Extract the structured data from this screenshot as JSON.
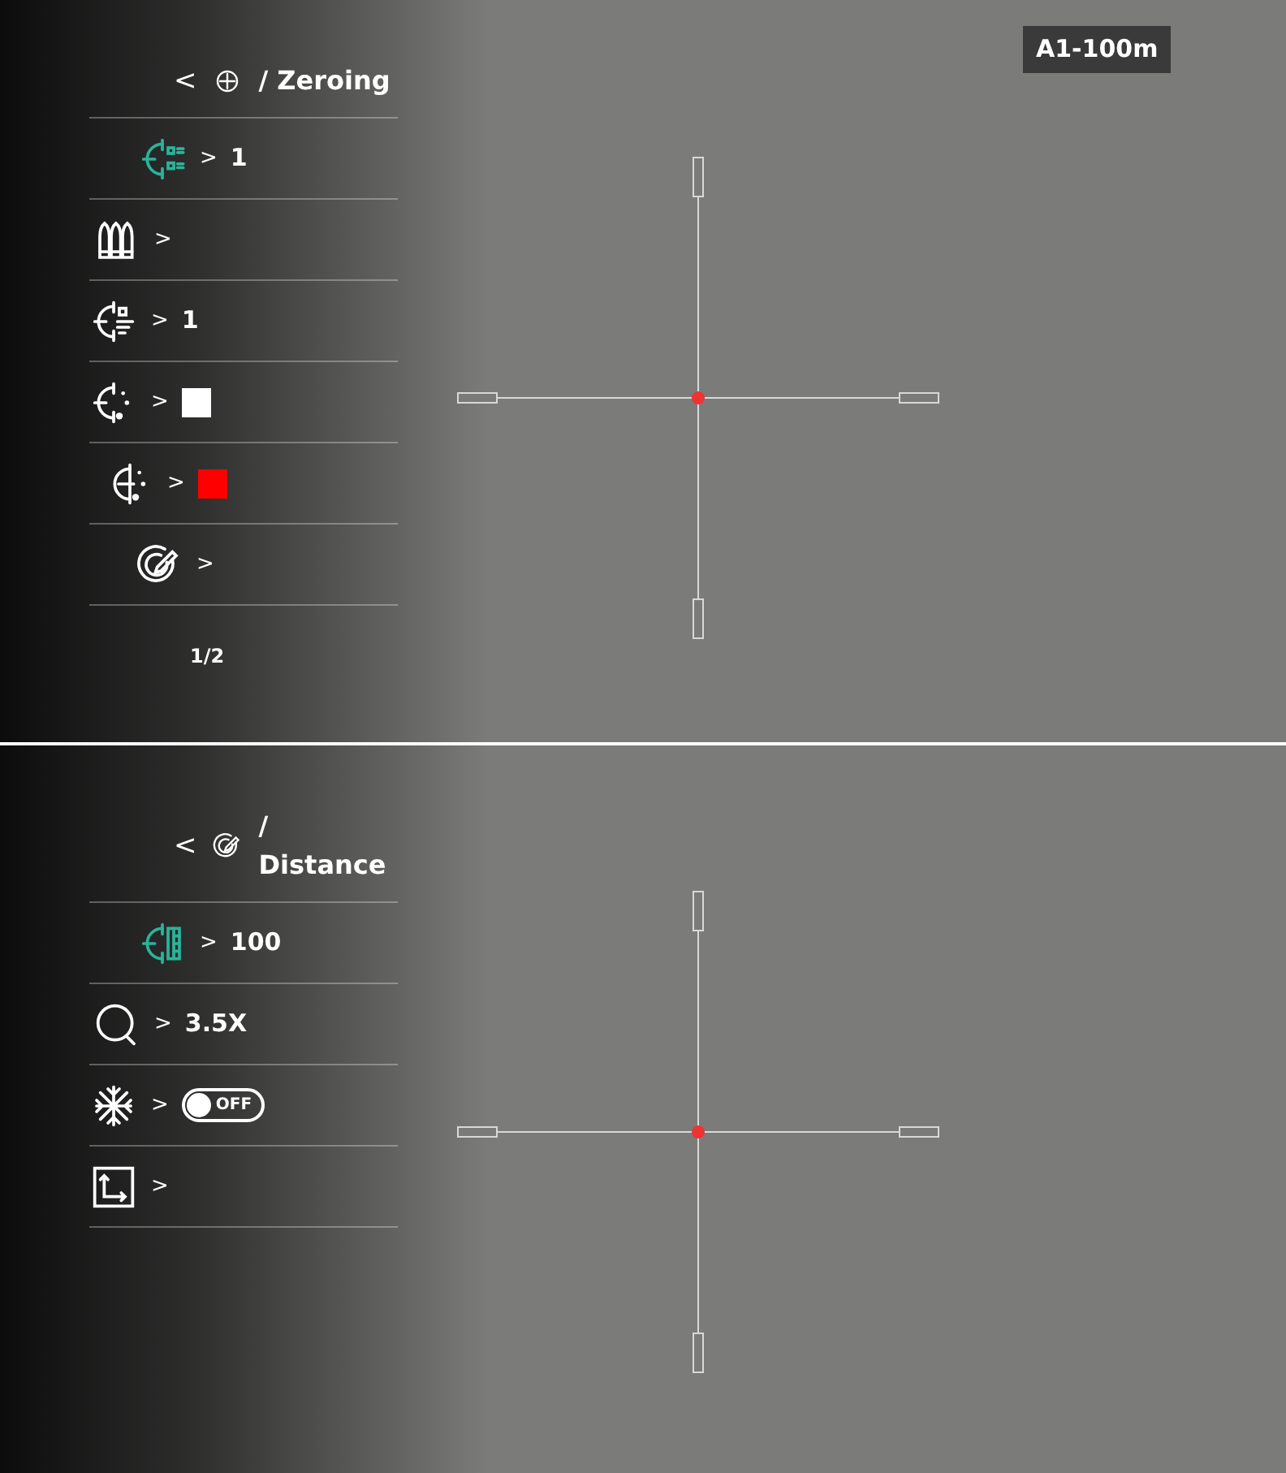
{
  "screens": [
    {
      "header": {
        "back": "<",
        "title": "/ Zeroing"
      },
      "badge": "A1-100m",
      "items": [
        {
          "kind": "text",
          "selected": true,
          "arrow": ">",
          "value": "1"
        },
        {
          "kind": "none",
          "selected": false,
          "arrow": ">"
        },
        {
          "kind": "text",
          "selected": false,
          "arrow": ">",
          "value": "1"
        },
        {
          "kind": "swatch",
          "selected": false,
          "arrow": ">",
          "color": "#ffffff"
        },
        {
          "kind": "swatch",
          "selected": false,
          "arrow": ">",
          "color": "#ff0000"
        },
        {
          "kind": "none",
          "selected": false,
          "arrow": ">"
        }
      ],
      "page": "1/2"
    },
    {
      "header": {
        "back": "<",
        "title": "/ Distance"
      },
      "items": [
        {
          "kind": "text",
          "selected": true,
          "arrow": ">",
          "value": "100"
        },
        {
          "kind": "text",
          "selected": false,
          "arrow": ">",
          "value": "3.5X"
        },
        {
          "kind": "toggle",
          "selected": false,
          "arrow": ">",
          "on": false,
          "label": "OFF"
        },
        {
          "kind": "none",
          "selected": false,
          "arrow": ">"
        }
      ]
    }
  ]
}
